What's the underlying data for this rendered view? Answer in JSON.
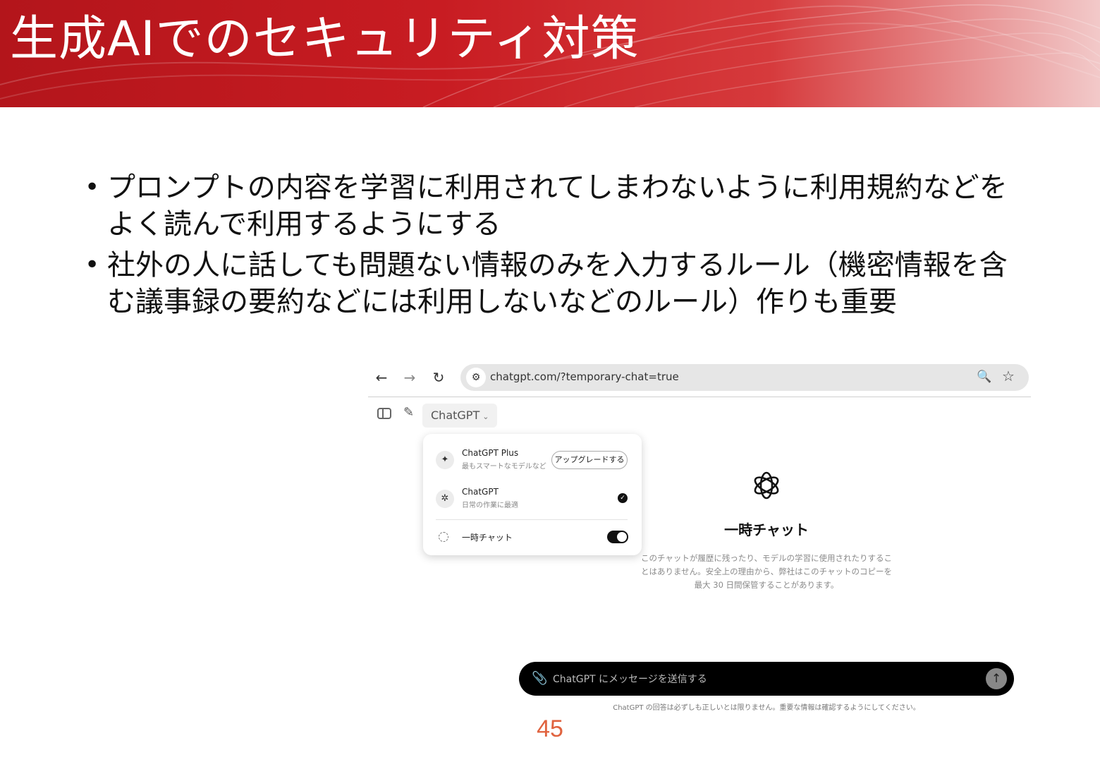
{
  "slide": {
    "title": "生成AIでのセキュリティ対策",
    "bullets": [
      "プロンプトの内容を学習に利用されてしまわないように利用規約などをよく読んで利用するようにする",
      "社外の人に話しても問題ない情報のみを入力するルール（機密情報を含む議事録の要約などには利用しないなどのルール）作りも重要"
    ],
    "bullet_marker": "•",
    "page_number": "45",
    "colors": {
      "header_red": "#c81c22",
      "page_number": "#e0633f"
    }
  },
  "browser": {
    "back_icon": "←",
    "forward_icon": "→",
    "reload_icon": "↻",
    "site_icon": "⚙",
    "url": "chatgpt.com/?temporary-chat=true",
    "zoom_icon": "🔍",
    "star_icon": "☆"
  },
  "chatgpt": {
    "new_chat_icon": "✎",
    "model_label": "ChatGPT",
    "model_chevron": "⌄",
    "menu": {
      "plus_icon": "✦",
      "plus_title": "ChatGPT Plus",
      "plus_sub": "最もスマートなモデルなど",
      "upgrade_label": "アップグレードする",
      "base_icon": "✲",
      "base_title": "ChatGPT",
      "base_sub": "日常の作業に最適",
      "check_icon": "✓",
      "temp_label": "一時チャット",
      "temp_toggle": "on"
    },
    "temp_title": "一時チャット",
    "temp_desc": "このチャットが履歴に残ったり、モデルの学習に使用されたりすることはありません。安全上の理由から、弊社はこのチャットのコピーを最大 30 日間保管することがあります。",
    "clip_icon": "📎",
    "input_placeholder": "ChatGPT にメッセージを送信する",
    "send_icon": "↑",
    "disclaimer": "ChatGPT の回答は必ずしも正しいとは限りません。重要な情報は確認するようにしてください。"
  }
}
